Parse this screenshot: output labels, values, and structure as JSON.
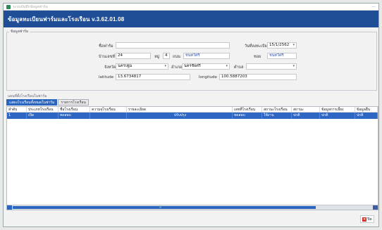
{
  "window": {
    "title": "ระบบบันทึกข้อมูลฟาร์ม",
    "close_glyph": "—"
  },
  "header": {
    "title": "ข้อมูลทะเบียนฟาร์มและโรงเรือน v.3.62.01.08"
  },
  "farm_group": {
    "label": "ข้อมูลฟาร์ม"
  },
  "form": {
    "farm_name_label": "ชื่อฟาร์ม",
    "farm_name_value": "",
    "reg_date_label": "วันที่ลงทะเบียน",
    "reg_date_value": "15/1/2562",
    "house_no_label": "บ้านเลขที่",
    "house_no_value": "24",
    "moo_label": "หมู่",
    "moo_value": "4",
    "road_label": "ถนน",
    "road_value": "ชนทวีศรี",
    "soi_label": "ซอย",
    "soi_value": "ชนทวีศรี",
    "province_label": "จังหวัด",
    "province_value": "นครปฐม",
    "district_label": "อำเภอ",
    "district_value": "นครชัยศรี",
    "subdistrict_label": "ตำบล",
    "subdistrict_value": "",
    "latitude_label": "latitude",
    "latitude_value": "13.6734817",
    "longitude_label": "longitude",
    "longitude_value": "100.5887203"
  },
  "section_label": "แผนที่ตั้งโรงเรือนในฟาร์ม",
  "tabs": [
    {
      "label": "แสดงโรงเรือนทั้งหมดในฟาร์ม"
    },
    {
      "label": "รายการโรงเรือน"
    }
  ],
  "grid": {
    "columns": [
      "ลำดับ",
      "ประเภทโรงเรือน",
      "ชื่อโรงเรือน",
      "ความจุโรงเรือน",
      "รายละเอียด",
      "เลขที่โรงเรือน",
      "สถานะโรงเรือน",
      "สถานะ",
      "ข้อมูลการเลี้ยง",
      "ข้อมูลอื่น"
    ],
    "rows": [
      [
        "1",
        "เปิด",
        "ทดสอบ",
        "",
        "ปรับปรุง",
        "ทดสอบ",
        "ใช้งาน",
        "ปกติ",
        "ปกติ",
        "ปกติ"
      ]
    ]
  },
  "footer": {
    "close_label": "ปิด",
    "close_icon": "x-icon"
  }
}
